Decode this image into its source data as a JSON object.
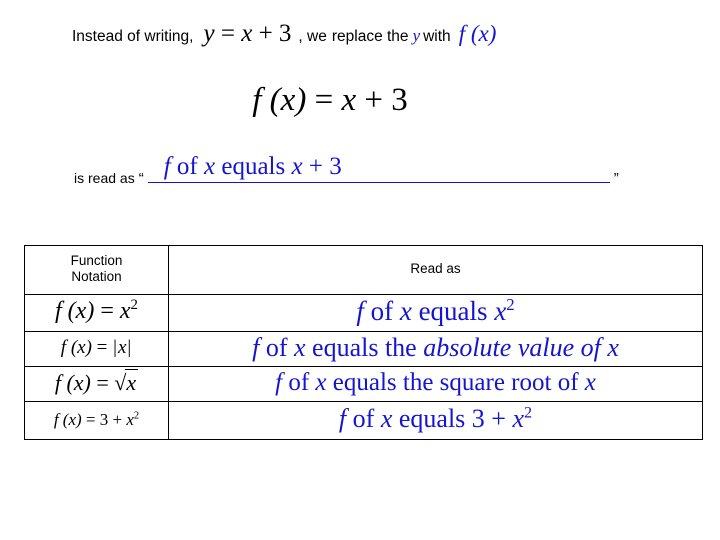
{
  "slide": {
    "title": "Function Notation",
    "background_color": "#ffffff",
    "accent_color": "#1414d2",
    "text_color": "#000000"
  },
  "intro": {
    "lead_text": "Instead of writing,",
    "equation_y": "y = x + 3",
    "equation_y_parts": {
      "lhs": "y",
      "rel": "=",
      "rhs_var": "x",
      "op": "+",
      "rhs_num": "3"
    },
    "comma_text": ", we",
    "middle_text": "replace the",
    "replaced_symbol": "y",
    "with_text": "with",
    "replacement_symbol": "f (x)"
  },
  "display_equation": {
    "lhs": "f (x)",
    "rel": "=",
    "rhs_var": "x",
    "op": "+",
    "rhs_num": "3",
    "full": "f (x) = x + 3"
  },
  "read_as_line": {
    "prompt": "is read as",
    "open_quote": "“",
    "close_quote": "”",
    "answer_prefix": "f",
    "answer_of": "of",
    "answer_var": "x",
    "answer_equals": "equals",
    "answer_rhs_var": "x",
    "answer_op": "+",
    "answer_rhs_num": "3",
    "answer_full": "f of x equals x + 3"
  },
  "table": {
    "headers": {
      "notation": "Function\nNotation",
      "notation_line1": "Function",
      "notation_line2": "Notation",
      "read_as": "Read as"
    },
    "rows": [
      {
        "notation_lhs": "f (x)",
        "notation_rel": "=",
        "notation_rhs_base": "x",
        "notation_rhs_exp": "2",
        "notation_text": "f (x) = x²",
        "read_prefix": "f",
        "read_of": "of",
        "read_var": "x",
        "read_equals": "equals",
        "read_tail_base": "x",
        "read_tail_exp": "2",
        "read_text": "f of x equals x²"
      },
      {
        "notation_lhs": "f (x)",
        "notation_rel": "=",
        "notation_rhs_abs": "x",
        "notation_text": "f (x) = |x|",
        "read_prefix": "f",
        "read_of": "of",
        "read_var": "x",
        "read_equals": "equals",
        "read_the": "the",
        "read_emphasis": "absolute value of",
        "read_tail_var": "x",
        "read_text": "f of x equals the absolute value of x"
      },
      {
        "notation_lhs": "f (x)",
        "notation_rel": "=",
        "notation_radical_sign": "√",
        "notation_radicand": "x",
        "notation_text": "f (x) = √x",
        "read_prefix": "f",
        "read_of": "of",
        "read_var": "x",
        "read_equals": "equals",
        "read_the": "the",
        "read_phrase": "square root of",
        "read_tail_var": "x",
        "read_text": "f of x equals the square root of x"
      },
      {
        "notation_lhs": "f (x)",
        "notation_rel": "=",
        "notation_rhs_num": "3",
        "notation_op": "+",
        "notation_rhs_base": "x",
        "notation_rhs_exp": "2",
        "notation_text": "f (x) = 3 + x²",
        "read_prefix": "f",
        "read_of": "of",
        "read_var": "x",
        "read_equals": "equals",
        "read_num": "3",
        "read_op": "+",
        "read_tail_base": "x",
        "read_tail_exp": "2",
        "read_text": "f of x equals 3 + x²"
      }
    ]
  }
}
